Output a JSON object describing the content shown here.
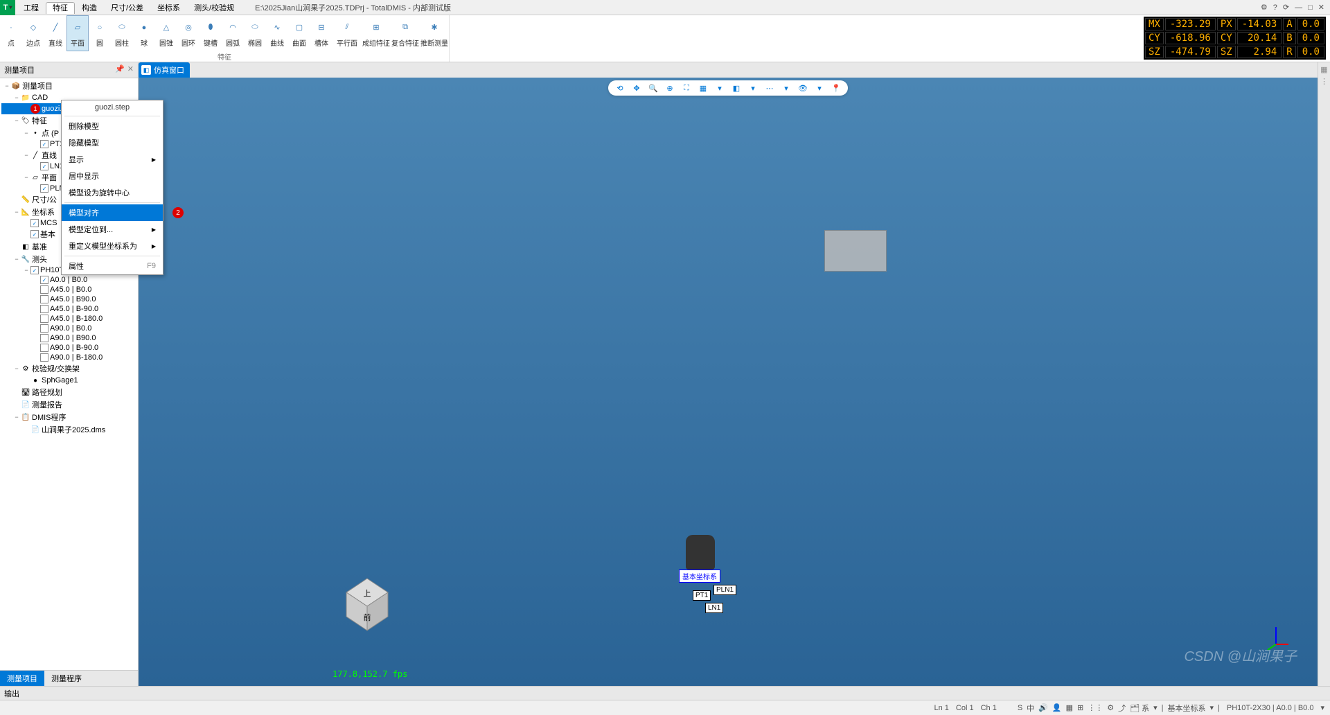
{
  "app_icon": "T",
  "menu": [
    "工程",
    "特征",
    "构造",
    "尺寸/公差",
    "坐标系",
    "测头/校验规"
  ],
  "active_menu_index": 1,
  "title_path": "E:\\2025Jian山涧果子2025.TDPrj - TotalDMIS - 内部测试版",
  "ribbon": {
    "items": [
      {
        "label": "点",
        "glyph": "·"
      },
      {
        "label": "边点",
        "glyph": "◇"
      },
      {
        "label": "直线",
        "glyph": "╱"
      },
      {
        "label": "平面",
        "glyph": "▱",
        "active": true
      },
      {
        "label": "圆",
        "glyph": "○"
      },
      {
        "label": "圆柱",
        "glyph": "⬭"
      },
      {
        "label": "球",
        "glyph": "●"
      },
      {
        "label": "圆锥",
        "glyph": "△"
      },
      {
        "label": "圆环",
        "glyph": "◎"
      },
      {
        "label": "键槽",
        "glyph": "⬮"
      },
      {
        "label": "圆弧",
        "glyph": "◠"
      },
      {
        "label": "椭圆",
        "glyph": "⬭"
      },
      {
        "label": "曲线",
        "glyph": "∿"
      },
      {
        "label": "曲面",
        "glyph": "▢"
      },
      {
        "label": "槽体",
        "glyph": "⊟"
      },
      {
        "label": "平行面",
        "glyph": "⫽"
      },
      {
        "label": "成组特征",
        "glyph": "⊞"
      },
      {
        "label": "复合特征",
        "glyph": "⧉"
      },
      {
        "label": "推断测量",
        "glyph": "✱"
      }
    ],
    "group_label": "特征"
  },
  "dro": {
    "rows": [
      {
        "l1": "MX",
        "v1": "-323.29",
        "l2": "PX",
        "v2": "-14.03",
        "l3": "A",
        "v3": "0.0"
      },
      {
        "l1": "CY",
        "v1": "-618.96",
        "l2": "CY",
        "v2": "20.14",
        "l3": "B",
        "v3": "0.0"
      },
      {
        "l1": "SZ",
        "v1": "-474.79",
        "l2": "SZ",
        "v2": "2.94",
        "l3": "R",
        "v3": "0.0"
      }
    ]
  },
  "left_panel": {
    "title": "测量项目",
    "root": "测量项目",
    "tree": [
      {
        "ind": 1,
        "toggle": "−",
        "icon": "📁",
        "label": "CAD"
      },
      {
        "ind": 2,
        "toggle": "",
        "icon": "",
        "label": "guozi.st",
        "selected": true,
        "badge": "1"
      },
      {
        "ind": 1,
        "toggle": "−",
        "icon": "🏷",
        "label": "特征"
      },
      {
        "ind": 2,
        "toggle": "−",
        "icon": "•",
        "label": "点 (P"
      },
      {
        "ind": 3,
        "toggle": "",
        "check": true,
        "label": "PT1"
      },
      {
        "ind": 2,
        "toggle": "−",
        "icon": "╱",
        "label": "直线"
      },
      {
        "ind": 3,
        "toggle": "",
        "check": true,
        "label": "LN1"
      },
      {
        "ind": 2,
        "toggle": "−",
        "icon": "▱",
        "label": "平面"
      },
      {
        "ind": 3,
        "toggle": "",
        "check": true,
        "label": "PLN"
      },
      {
        "ind": 1,
        "toggle": "",
        "icon": "📏",
        "label": "尺寸/公"
      },
      {
        "ind": 1,
        "toggle": "−",
        "icon": "📐",
        "label": "坐标系"
      },
      {
        "ind": 2,
        "toggle": "",
        "check": true,
        "label": "MCS"
      },
      {
        "ind": 2,
        "toggle": "",
        "check": true,
        "label": "基本"
      },
      {
        "ind": 1,
        "toggle": "",
        "icon": "◧",
        "label": "基准"
      },
      {
        "ind": 1,
        "toggle": "−",
        "icon": "🔧",
        "label": "测头"
      },
      {
        "ind": 2,
        "toggle": "−",
        "check": true,
        "label": "PH10T-2X30"
      },
      {
        "ind": 3,
        "toggle": "",
        "check": true,
        "label": "A0.0  | B0.0"
      },
      {
        "ind": 3,
        "toggle": "",
        "check": false,
        "label": "A45.0 | B0.0"
      },
      {
        "ind": 3,
        "toggle": "",
        "check": false,
        "label": "A45.0 | B90.0"
      },
      {
        "ind": 3,
        "toggle": "",
        "check": false,
        "label": "A45.0 | B-90.0"
      },
      {
        "ind": 3,
        "toggle": "",
        "check": false,
        "label": "A45.0 | B-180.0"
      },
      {
        "ind": 3,
        "toggle": "",
        "check": false,
        "label": "A90.0 | B0.0"
      },
      {
        "ind": 3,
        "toggle": "",
        "check": false,
        "label": "A90.0 | B90.0"
      },
      {
        "ind": 3,
        "toggle": "",
        "check": false,
        "label": "A90.0 | B-90.0"
      },
      {
        "ind": 3,
        "toggle": "",
        "check": false,
        "label": "A90.0 | B-180.0"
      },
      {
        "ind": 1,
        "toggle": "−",
        "icon": "⚙",
        "label": "校验规/交换架"
      },
      {
        "ind": 2,
        "toggle": "",
        "icon": "●",
        "label": "SphGage1"
      },
      {
        "ind": 1,
        "toggle": "",
        "icon": "🛣",
        "label": "路径规划"
      },
      {
        "ind": 1,
        "toggle": "",
        "icon": "📄",
        "label": "测量报告"
      },
      {
        "ind": 1,
        "toggle": "−",
        "icon": "📋",
        "label": "DMIS程序"
      },
      {
        "ind": 2,
        "toggle": "",
        "icon": "📄",
        "label": "山涧果子2025.dms"
      }
    ],
    "bottom_tabs": [
      "测量项目",
      "测量程序"
    ],
    "active_bottom_tab": 0
  },
  "context_menu": {
    "title": "guozi.step",
    "items": [
      {
        "label": "删除模型"
      },
      {
        "label": "隐藏模型"
      },
      {
        "label": "显示",
        "submenu": true
      },
      {
        "label": "居中显示"
      },
      {
        "label": "模型设为旋转中心"
      },
      {
        "label": "模型对齐",
        "highlight": true,
        "badge": "2"
      },
      {
        "label": "模型定位到...",
        "submenu": true
      },
      {
        "label": "重定义模型坐标系为",
        "submenu": true
      },
      {
        "label": "属性",
        "shortcut": "F9"
      }
    ]
  },
  "viewport": {
    "tab": "仿真窗口",
    "toolbar_icons": [
      "⟲",
      "✥",
      "🔍",
      "⊕",
      "⛶",
      "▦",
      "▾",
      "◧",
      "▾",
      "⋯",
      "▾",
      "👁",
      "▾",
      "📍"
    ],
    "coord_label": "基本坐标系",
    "feat_labels": [
      "PT1",
      "PLN1",
      "LN1"
    ],
    "fps": "177.8,152.7 fps",
    "nav_faces": {
      "top": "上",
      "front": "前"
    }
  },
  "output_panel_title": "输出",
  "statusbar": {
    "left": [
      "Ln 1",
      "Col 1",
      "Ch 1"
    ],
    "icons": [
      "S",
      "中",
      "🔊",
      "👤",
      "▦",
      "⊞",
      "⋮⋮",
      "⚙",
      "⤴",
      "🗂 系",
      "▾",
      "|",
      "基本坐标系",
      "▾",
      "|"
    ],
    "probe": "PH10T-2X30 | A0.0  | B0.0",
    "arrow": "▾"
  },
  "watermark": "CSDN @山涧果子"
}
